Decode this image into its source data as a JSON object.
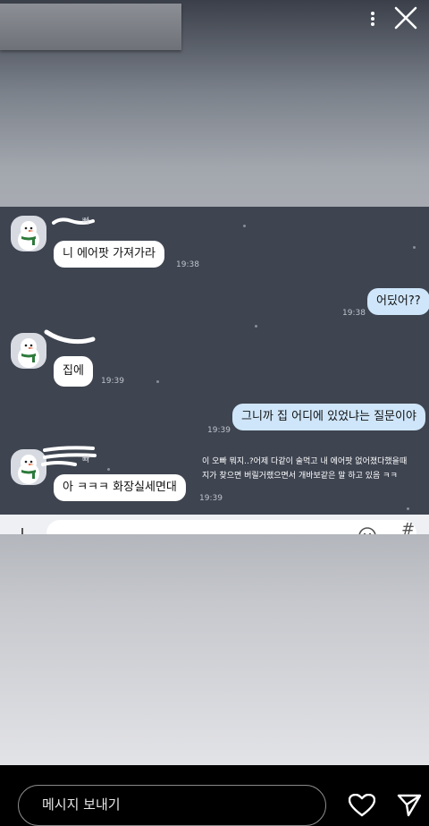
{
  "story": {
    "top_icons": {
      "more": "more-vertical-icon",
      "close": "close-icon"
    }
  },
  "chat": {
    "messages": [
      {
        "sender": "1",
        "name_visible": "빠",
        "text": "니 에어팟 가져가라",
        "time": "19:38",
        "direction": "in"
      },
      {
        "text": "어딨어??",
        "time": "19:38",
        "direction": "out"
      },
      {
        "sender": "2",
        "text": "집에",
        "time": "19:39",
        "direction": "in"
      },
      {
        "text": "그니까 집 어디에 있었냐는 질문이야",
        "time": "19:39",
        "direction": "out"
      },
      {
        "sender": "3",
        "name_visible": "빠",
        "text": "아 ㅋㅋㅋ 화장실세면대",
        "time": "19:39",
        "direction": "in"
      }
    ],
    "caption_lines": [
      "이 오빠 뭐지..?어제 다같이 술먹고 내 에어팟 없어졌다했을때",
      "지가 찾으면 버릴거랬으면서 개바보같은 말 하고 있음 ㅋㅋ"
    ],
    "input_icons": {
      "emoji": "emoji-icon",
      "hash": "#"
    }
  },
  "bottom": {
    "message_placeholder": "메시지 보내기",
    "icons": {
      "like": "heart-icon",
      "share": "send-icon"
    }
  },
  "colors": {
    "chat_bg": "#3e4450",
    "outgoing_bubble": "#cfe6fa",
    "incoming_bubble": "#ffffff"
  }
}
